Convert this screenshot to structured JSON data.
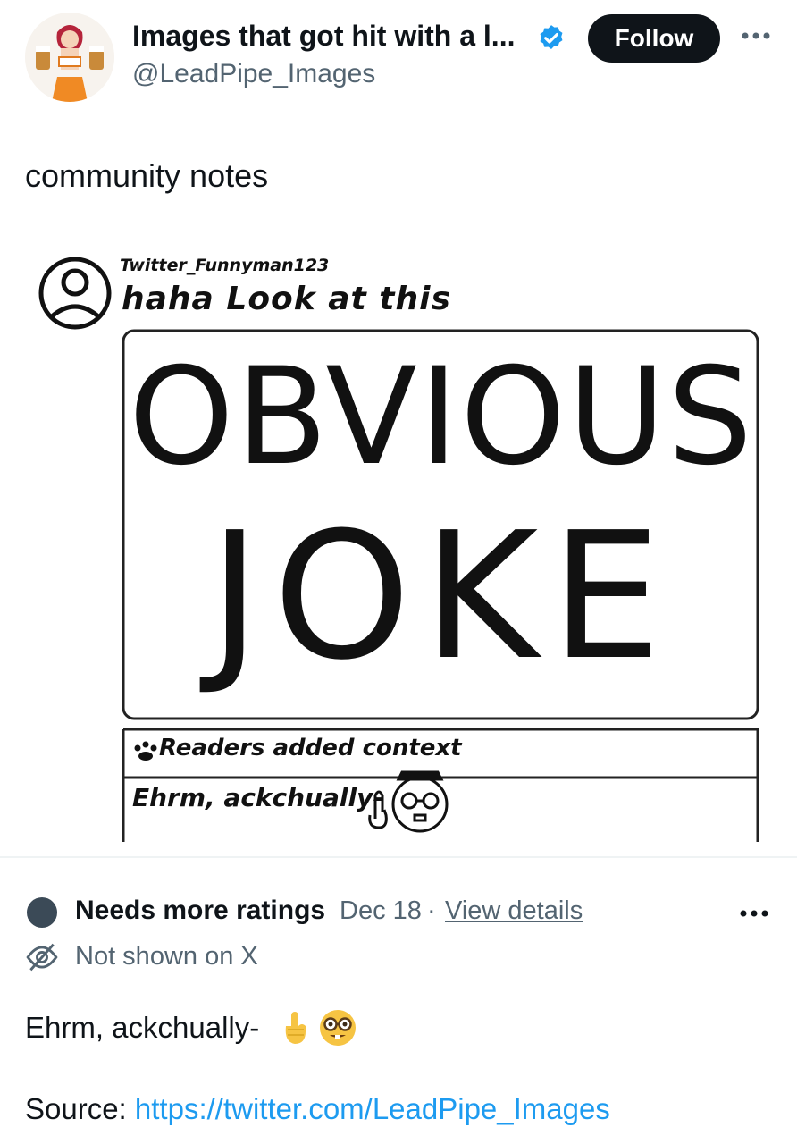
{
  "author": {
    "display_name": "Images that got hit with a l...",
    "handle": "@LeadPipe_Images",
    "verified": true,
    "avatar_icon": "anime-waitress-avatar"
  },
  "follow_label": "Follow",
  "tweet_text": "community notes",
  "meme": {
    "username": "Twitter_Funnyman123",
    "caption": "haha Look at this",
    "big_line1": "OBVIOUS",
    "big_line2": "JOKE",
    "context_label": "Readers added context",
    "context_text": "Ehrm, ackchually-"
  },
  "note": {
    "status": "Needs more ratings",
    "date": "Dec 18",
    "separator": "·",
    "details_link": "View details",
    "visibility": "Not shown on X",
    "body": "Ehrm, ackchually-",
    "source_label": "Source:",
    "source_url": "https://twitter.com/LeadPipe_Images"
  },
  "colors": {
    "text": "#0f1419",
    "secondary": "#536471",
    "link": "#1d9bf0",
    "verified": "#1d9bf0",
    "status_dot": "#3b4a57"
  }
}
